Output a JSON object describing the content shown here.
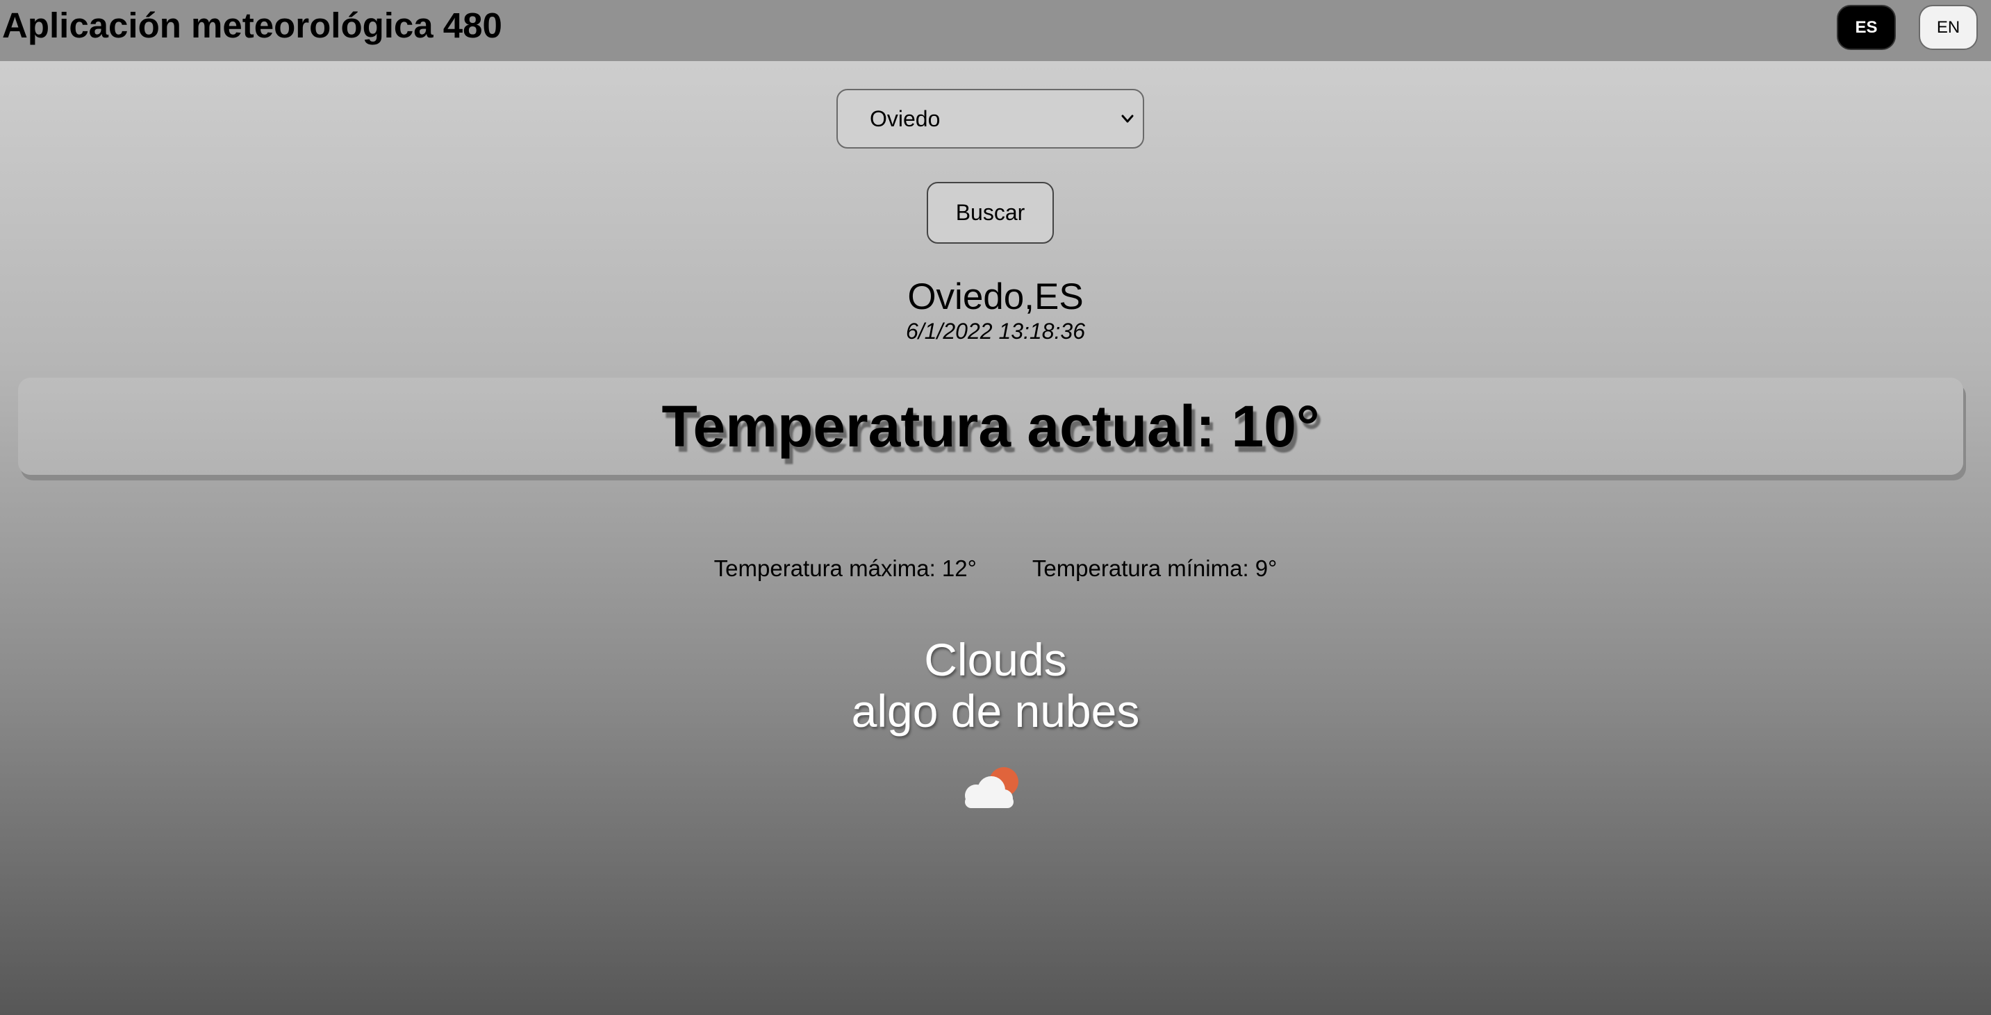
{
  "header": {
    "title": "Aplicación meteorológica 480",
    "lang_es": "ES",
    "lang_en": "EN"
  },
  "search": {
    "selected_city": "Oviedo",
    "button_label": "Buscar"
  },
  "weather": {
    "location": "Oviedo,ES",
    "datetime": "6/1/2022 13:18:36",
    "current_temp": "Temperatura actual: 10°",
    "max_temp": "Temperatura máxima: 12°",
    "min_temp": "Temperatura mínima: 9°",
    "condition": "Clouds",
    "description": "algo de nubes",
    "icon": "partly-cloudy-icon"
  },
  "colors": {
    "active_lang_bg": "#000000",
    "sun": "#e0643c",
    "cloud": "#f4f4f4"
  }
}
